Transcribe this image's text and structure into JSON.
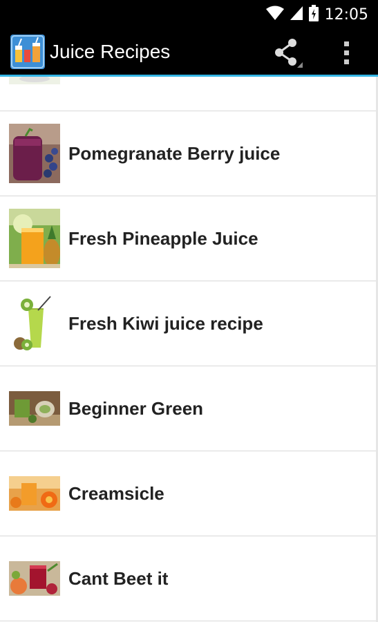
{
  "status_bar": {
    "time": "12:05"
  },
  "action_bar": {
    "title": "Juice Recipes"
  },
  "recipes": [
    {
      "label": "",
      "icon": "green-juice-thumbnail"
    },
    {
      "label": "Pomegranate Berry juice",
      "icon": "berry-juice-thumbnail"
    },
    {
      "label": "Fresh Pineapple Juice",
      "icon": "pineapple-juice-thumbnail"
    },
    {
      "label": "Fresh Kiwi juice recipe",
      "icon": "kiwi-juice-thumbnail"
    },
    {
      "label": "Beginner Green",
      "icon": "green-juice-thumbnail"
    },
    {
      "label": "Creamsicle",
      "icon": "orange-juice-thumbnail"
    },
    {
      "label": "Cant Beet it",
      "icon": "beet-juice-thumbnail"
    }
  ],
  "colors": {
    "accent": "#33b5e5",
    "action_bar": "#000000",
    "list_background": "#ffffff"
  }
}
